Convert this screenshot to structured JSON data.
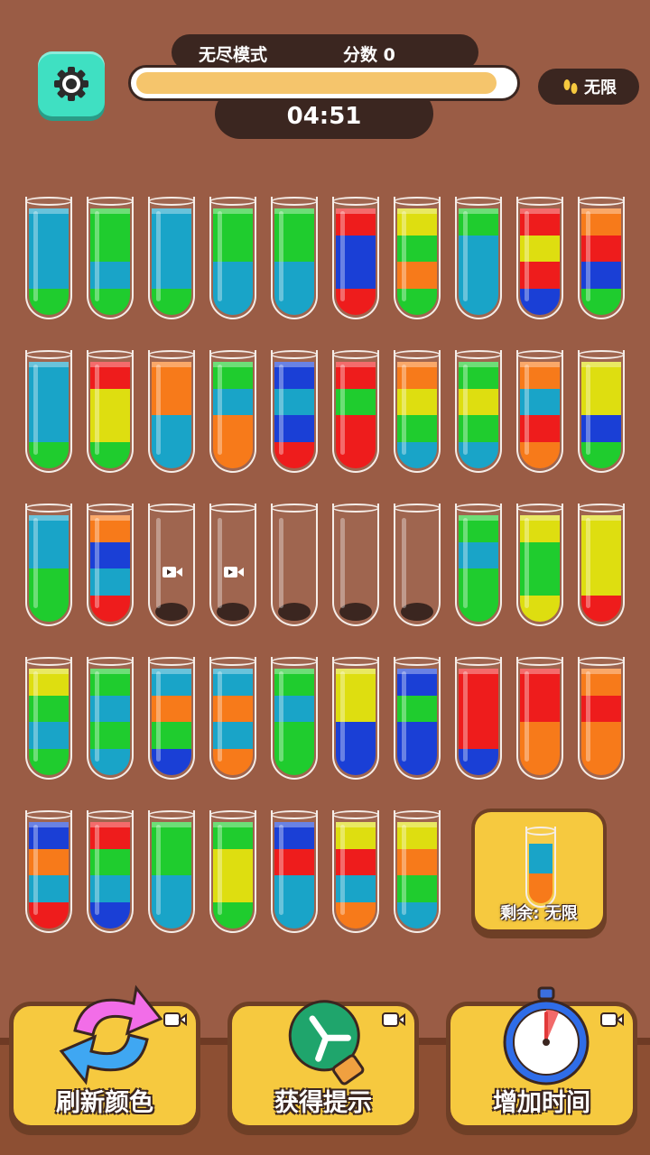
{
  "header": {
    "mode_label": "无尽模式",
    "score_label": "分数 0",
    "timer": "04:51",
    "moves_label": "无限",
    "progress": 0.96
  },
  "colors": {
    "G": "#1fcc2e",
    "B": "#19a4c8",
    "D": "#1a3fd6",
    "R": "#ee1c1c",
    "O": "#f77a1a",
    "Y": "#dede10"
  },
  "tubes": [
    [
      "B",
      "B",
      "B",
      "G"
    ],
    [
      "G",
      "G",
      "B",
      "G"
    ],
    [
      "B",
      "B",
      "B",
      "G"
    ],
    [
      "G",
      "G",
      "B",
      "B"
    ],
    [
      "G",
      "G",
      "B",
      "B"
    ],
    [
      "R",
      "D",
      "D",
      "R"
    ],
    [
      "Y",
      "G",
      "O",
      "G"
    ],
    [
      "G",
      "B",
      "B",
      "B"
    ],
    [
      "R",
      "Y",
      "R",
      "D"
    ],
    [
      "O",
      "R",
      "D",
      "G"
    ],
    [
      "B",
      "B",
      "B",
      "G"
    ],
    [
      "R",
      "Y",
      "Y",
      "G"
    ],
    [
      "O",
      "O",
      "B",
      "B"
    ],
    [
      "G",
      "B",
      "O",
      "O"
    ],
    [
      "D",
      "B",
      "D",
      "R"
    ],
    [
      "R",
      "G",
      "R",
      "R"
    ],
    [
      "O",
      "Y",
      "G",
      "B"
    ],
    [
      "G",
      "Y",
      "G",
      "B"
    ],
    [
      "O",
      "B",
      "R",
      "O"
    ],
    [
      "Y",
      "Y",
      "D",
      "G"
    ],
    [
      "B",
      "B",
      "G",
      "G"
    ],
    [
      "O",
      "D",
      "B",
      "R"
    ],
    [],
    [],
    [],
    [],
    [],
    [
      "G",
      "B",
      "G",
      "G"
    ],
    [
      "Y",
      "G",
      "G",
      "Y"
    ],
    [
      "Y",
      "Y",
      "Y",
      "R"
    ],
    [
      "Y",
      "G",
      "B",
      "G"
    ],
    [
      "G",
      "B",
      "G",
      "B"
    ],
    [
      "B",
      "O",
      "G",
      "D"
    ],
    [
      "B",
      "O",
      "B",
      "O"
    ],
    [
      "G",
      "B",
      "G",
      "G"
    ],
    [
      "Y",
      "Y",
      "D",
      "D"
    ],
    [
      "D",
      "G",
      "D",
      "D"
    ],
    [
      "R",
      "R",
      "R",
      "D"
    ],
    [
      "R",
      "R",
      "O",
      "O"
    ],
    [
      "O",
      "R",
      "O",
      "O"
    ],
    [
      "D",
      "O",
      "B",
      "R"
    ],
    [
      "R",
      "G",
      "B",
      "D"
    ],
    [
      "G",
      "G",
      "B",
      "B"
    ],
    [
      "G",
      "Y",
      "Y",
      "G"
    ],
    [
      "D",
      "R",
      "B",
      "B"
    ],
    [
      "Y",
      "R",
      "B",
      "O"
    ],
    [
      "Y",
      "O",
      "G",
      "B"
    ]
  ],
  "video_tubes": [
    22,
    23
  ],
  "remaining": {
    "label": "剩余: 无限",
    "tube": [
      "B",
      "O"
    ]
  },
  "actions": [
    {
      "label": "刷新颜色"
    },
    {
      "label": "获得提示"
    },
    {
      "label": "增加时间"
    }
  ]
}
